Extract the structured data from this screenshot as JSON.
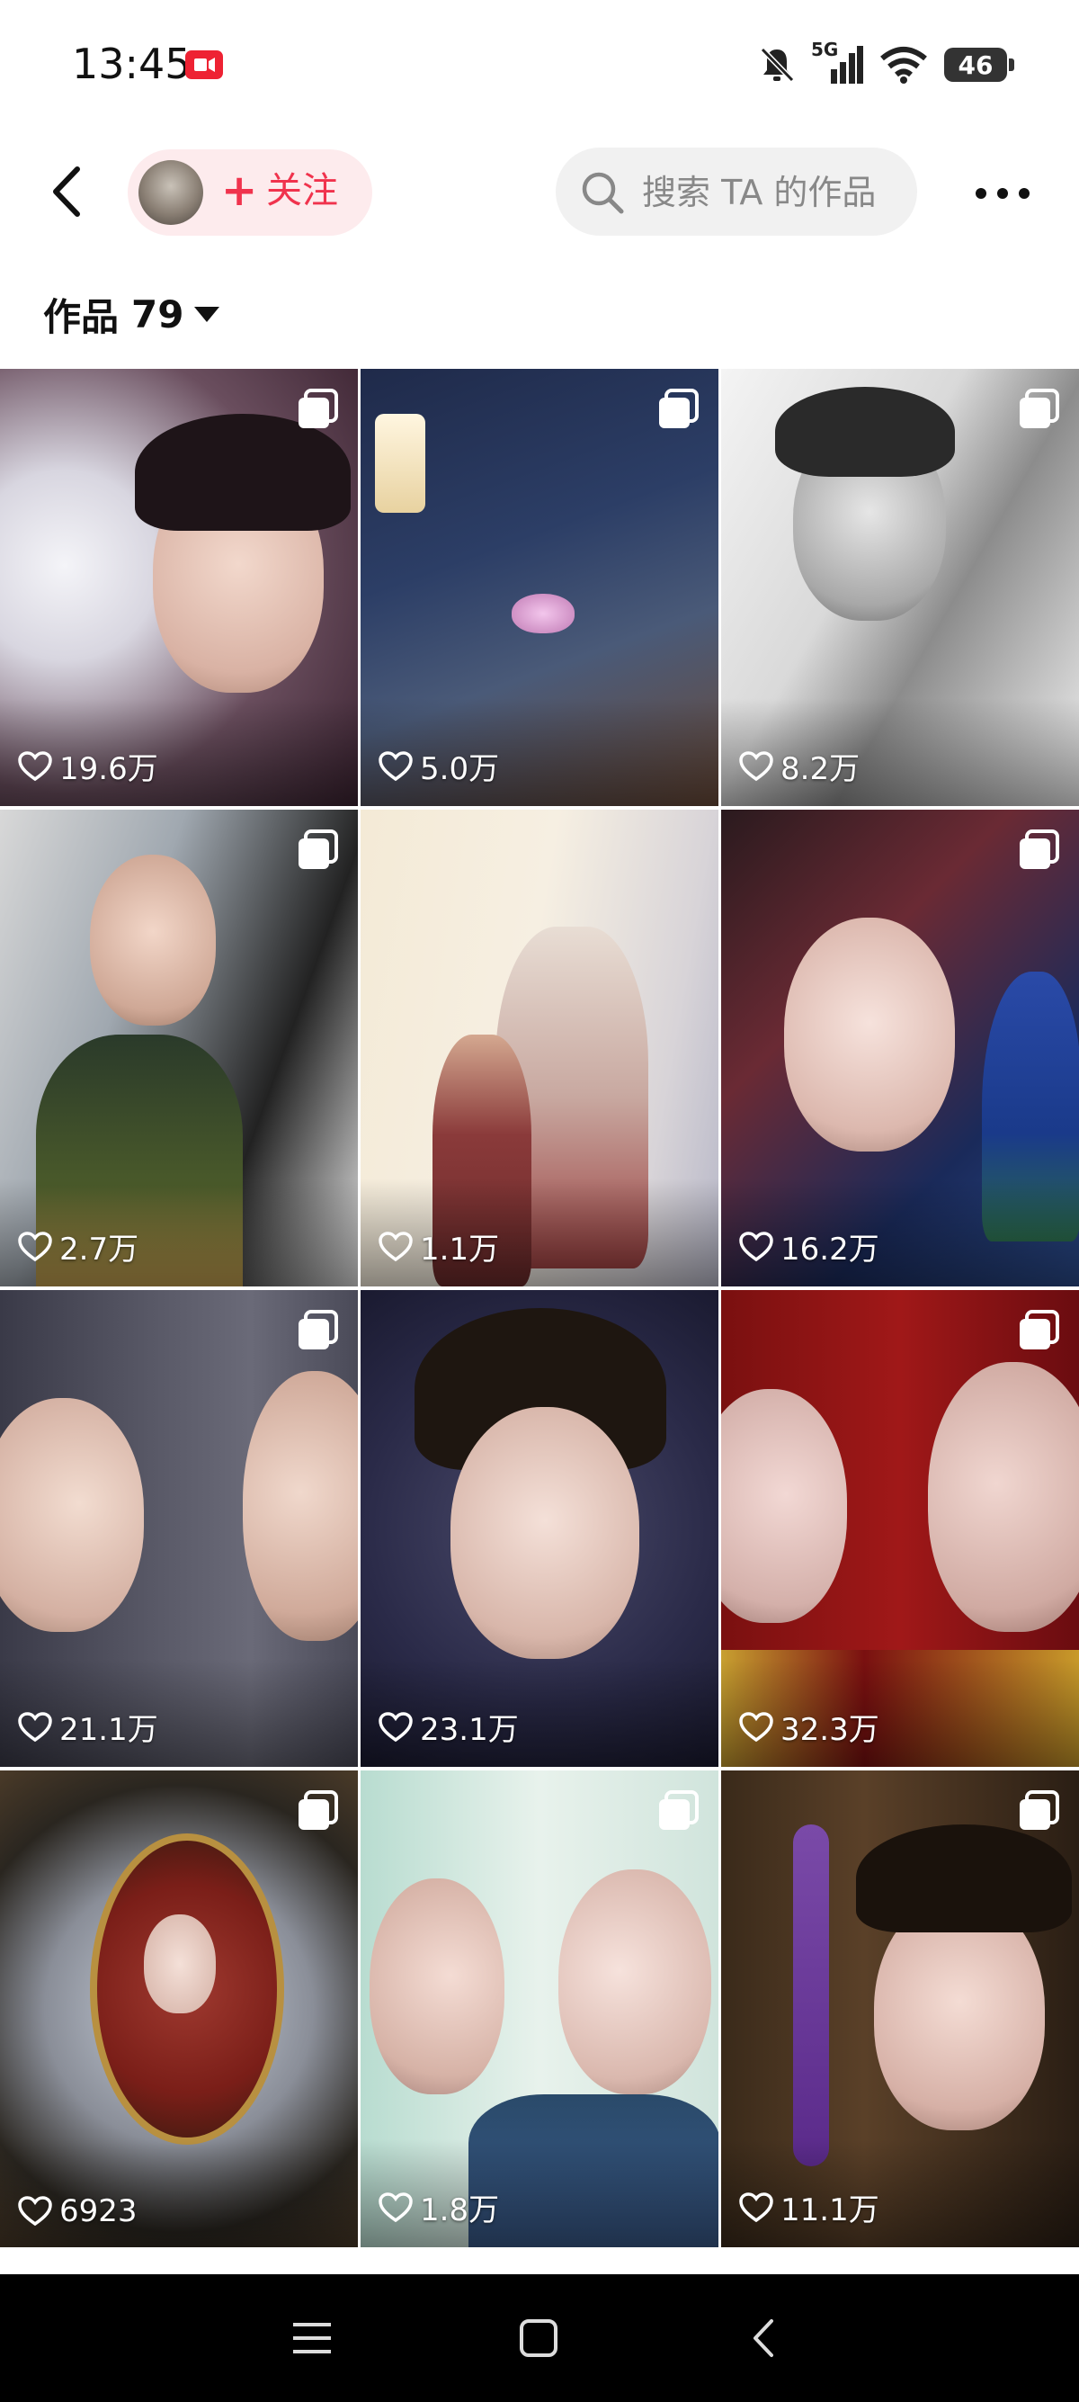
{
  "status_bar": {
    "time": "13:45",
    "network": "5G",
    "battery": "46",
    "icons": [
      "screen-record-icon",
      "mute-bell-icon",
      "signal-icon",
      "wifi-icon",
      "battery-icon"
    ]
  },
  "header": {
    "follow_label": "关注",
    "follow_plus": "+",
    "search_placeholder": "搜索 TA 的作品",
    "accent_color": "#f0334d"
  },
  "works": {
    "label": "作品",
    "count": "79"
  },
  "tiles": [
    {
      "likes": "19.6万",
      "multi": true
    },
    {
      "likes": "5.0万",
      "multi": true
    },
    {
      "likes": "8.2万",
      "multi": true
    },
    {
      "likes": "2.7万",
      "multi": true
    },
    {
      "likes": "1.1万",
      "multi": false
    },
    {
      "likes": "16.2万",
      "multi": true
    },
    {
      "likes": "21.1万",
      "multi": true
    },
    {
      "likes": "23.1万",
      "multi": false
    },
    {
      "likes": "32.3万",
      "multi": true
    },
    {
      "likes": "6923",
      "multi": true
    },
    {
      "likes": "1.8万",
      "multi": true
    },
    {
      "likes": "11.1万",
      "multi": true
    }
  ],
  "nav_bar": {
    "icons": [
      "menu-icon",
      "home-icon",
      "back-icon"
    ]
  }
}
